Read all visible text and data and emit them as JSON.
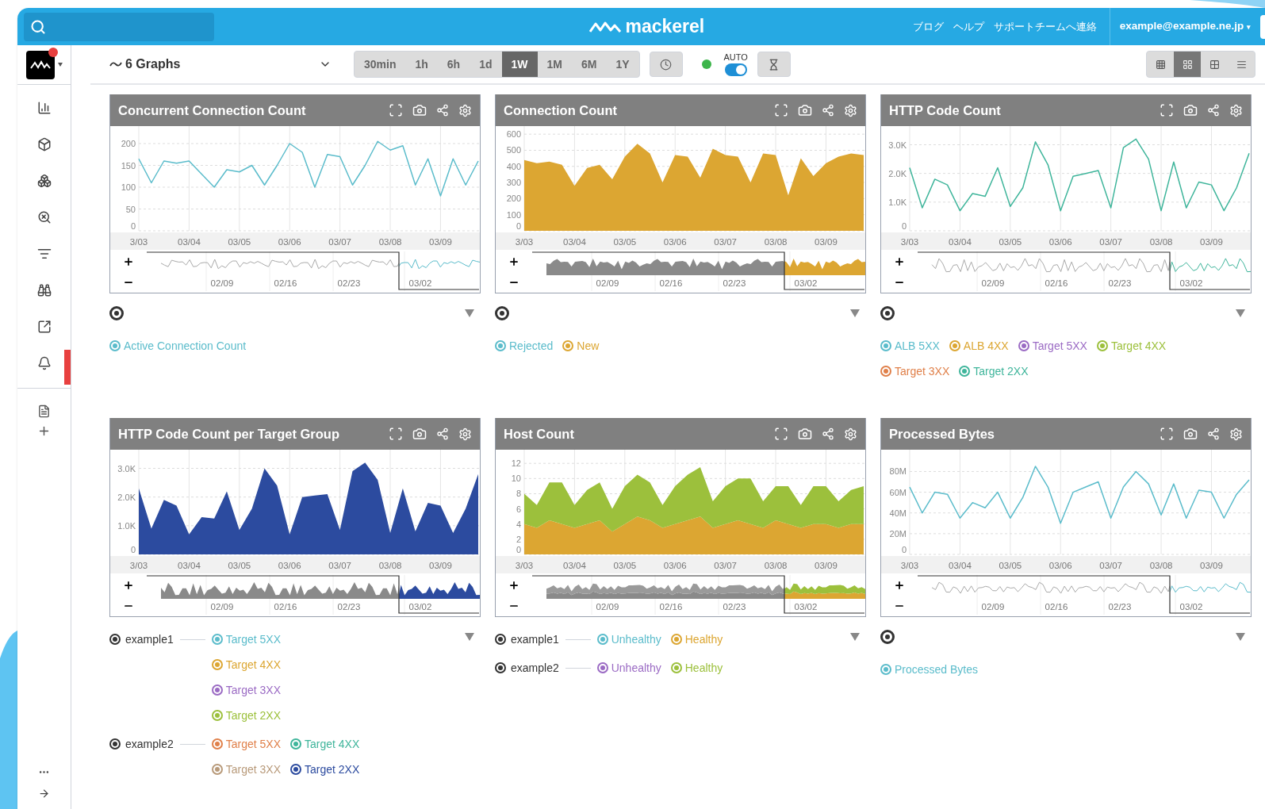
{
  "topbar": {
    "logo": "mackerel",
    "links": [
      "ブログ",
      "ヘルプ",
      "サポートチームへ連絡"
    ],
    "account": "example@example.ne.jp",
    "account_caret": "▾"
  },
  "sidebar": {
    "main": [
      {
        "kind": "chart",
        "alert": false
      },
      {
        "kind": "cube",
        "alert": false
      },
      {
        "kind": "cubes",
        "alert": false
      },
      {
        "kind": "inspect",
        "alert": false
      },
      {
        "kind": "filter",
        "alert": false
      },
      {
        "kind": "binoculars",
        "alert": false
      },
      {
        "kind": "export",
        "alert": false
      },
      {
        "kind": "bell",
        "alert": true
      }
    ],
    "secondary": [
      {
        "kind": "document"
      },
      {
        "kind": "add"
      }
    ],
    "bottom": [
      {
        "kind": "more"
      },
      {
        "kind": "collapse"
      }
    ]
  },
  "toolbar": {
    "graph_picker": "6 Graphs",
    "ranges": [
      {
        "label": "30min",
        "selected": false
      },
      {
        "label": "1h",
        "selected": false
      },
      {
        "label": "6h",
        "selected": false
      },
      {
        "label": "1d",
        "selected": false
      },
      {
        "label": "1W",
        "selected": true
      },
      {
        "label": "1M",
        "selected": false
      },
      {
        "label": "6M",
        "selected": false
      },
      {
        "label": "1Y",
        "selected": false
      }
    ],
    "connected": true,
    "auto_refresh": {
      "label": "AUTO",
      "on": true
    },
    "layouts": [
      {
        "kind": "dense",
        "selected": false
      },
      {
        "kind": "grid3",
        "selected": true
      },
      {
        "kind": "grid2",
        "selected": false
      },
      {
        "kind": "list",
        "selected": false
      }
    ]
  },
  "graphs": [
    {
      "title": "Concurrent Connection Count",
      "chart_data": {
        "type": "line",
        "categories": [
          "3/03",
          null,
          null,
          null,
          "03/04",
          null,
          null,
          null,
          "03/05",
          null,
          null,
          null,
          "03/06",
          null,
          null,
          null,
          "03/07",
          null,
          null,
          null,
          "03/08",
          null,
          null,
          null,
          "03/09",
          null,
          null,
          null
        ],
        "grid": true,
        "ylim": [
          0,
          240
        ],
        "yticks": [
          0,
          50,
          100,
          150,
          200
        ],
        "series": [
          {
            "color": "#5bbccb",
            "values": [
              165,
              110,
              160,
              155,
              160,
              130,
              100,
              140,
              135,
              150,
              105,
              150,
              200,
              180,
              100,
              175,
              170,
              105,
              150,
              205,
              185,
              195,
              105,
              165,
              80,
              165,
              105,
              160
            ]
          }
        ]
      },
      "navigator": {
        "dates": [
          "02/09",
          "02/16",
          "02/23",
          "03/02"
        ]
      },
      "legend": {
        "groups": [
          {
            "rows": [
              [
                {
                  "label": "Active Connection Count",
                  "color": "#5bbccb"
                }
              ]
            ]
          }
        ]
      }
    },
    {
      "title": "Connection Count",
      "chart_data": {
        "type": "area",
        "categories": [
          "3/03",
          null,
          null,
          null,
          "03/04",
          null,
          null,
          null,
          "03/05",
          null,
          null,
          null,
          "03/06",
          null,
          null,
          null,
          "03/07",
          null,
          null,
          null,
          "03/08",
          null,
          null,
          null,
          "03/09",
          null,
          null,
          null
        ],
        "grid": true,
        "ylim": [
          0,
          650
        ],
        "yticks": [
          0,
          100,
          200,
          300,
          400,
          500,
          600
        ],
        "series": [
          {
            "color": "#dca632",
            "values": [
              440,
              420,
              430,
              410,
              280,
              390,
              410,
              320,
              460,
              540,
              480,
              300,
              470,
              460,
              330,
              510,
              470,
              460,
              300,
              480,
              470,
              220,
              450,
              340,
              420,
              460,
              480,
              470
            ]
          }
        ]
      },
      "navigator": {
        "dates": [
          "02/09",
          "02/16",
          "02/23",
          "03/02"
        ]
      },
      "legend": {
        "groups": [
          {
            "rows": [
              [
                {
                  "label": "Rejected",
                  "color": "#5bbccb"
                },
                {
                  "label": "New",
                  "color": "#dca632"
                }
              ]
            ]
          }
        ]
      }
    },
    {
      "title": "HTTP Code Count",
      "chart_data": {
        "type": "line",
        "categories": [
          "3/03",
          null,
          null,
          null,
          "03/04",
          null,
          null,
          null,
          "03/05",
          null,
          null,
          null,
          "03/06",
          null,
          null,
          null,
          "03/07",
          null,
          null,
          null,
          "03/08",
          null,
          null,
          null,
          "03/09",
          null,
          null,
          null
        ],
        "grid": true,
        "ylim": [
          0,
          3650
        ],
        "yticks": [
          {
            "value": 0,
            "label": "0"
          },
          {
            "value": 1000,
            "label": "1.0K"
          },
          {
            "value": 2000,
            "label": "2.0K"
          },
          {
            "value": 3000,
            "label": "3.0K"
          }
        ],
        "series": [
          {
            "color": "#3fb59b",
            "values": [
              2200,
              800,
              1800,
              1600,
              700,
              1300,
              1200,
              2200,
              850,
              1500,
              3100,
              2300,
              700,
              1900,
              2000,
              2100,
              800,
              2900,
              3200,
              2500,
              700,
              2400,
              800,
              1700,
              1600,
              700,
              1500,
              2700
            ]
          }
        ]
      },
      "navigator": {
        "dates": [
          "02/09",
          "02/16",
          "02/23",
          "03/02"
        ]
      },
      "legend": {
        "groups": [
          {
            "rows": [
              [
                {
                  "label": "ALB 5XX",
                  "color": "#5bbccb"
                },
                {
                  "label": "ALB 4XX",
                  "color": "#dca632"
                },
                {
                  "label": "Target 5XX",
                  "color": "#9b6bc4"
                },
                {
                  "label": "Target 4XX",
                  "color": "#9cc03c"
                }
              ],
              [
                {
                  "label": "Target 3XX",
                  "color": "#e0804a"
                },
                {
                  "label": "Target 2XX",
                  "color": "#3fb59b"
                }
              ]
            ]
          }
        ]
      }
    },
    {
      "title": "HTTP Code Count per Target Group",
      "chart_data": {
        "type": "area",
        "categories": [
          "3/03",
          null,
          null,
          null,
          "03/04",
          null,
          null,
          null,
          "03/05",
          null,
          null,
          null,
          "03/06",
          null,
          null,
          null,
          "03/07",
          null,
          null,
          null,
          "03/08",
          null,
          null,
          null,
          "03/09",
          null,
          null,
          null
        ],
        "grid": true,
        "ylim": [
          0,
          3650
        ],
        "yticks": [
          {
            "value": 0,
            "label": "0"
          },
          {
            "value": 1000,
            "label": "1.0K"
          },
          {
            "value": 2000,
            "label": "2.0K"
          },
          {
            "value": 3000,
            "label": "3.0K"
          }
        ],
        "series": [
          {
            "color": "#2c4b9f",
            "values": [
              2300,
              900,
              1900,
              1700,
              700,
              1300,
              1250,
              2200,
              850,
              1600,
              3000,
              2400,
              700,
              2000,
              2050,
              2100,
              850,
              2900,
              3200,
              2600,
              750,
              2300,
              800,
              1800,
              1700,
              750,
              1600,
              2800
            ]
          }
        ]
      },
      "navigator": {
        "dates": [
          "02/09",
          "02/16",
          "02/23",
          "03/02"
        ]
      },
      "legend": {
        "groups": [
          {
            "host": "example1",
            "rows": [
              [
                {
                  "label": "Target 5XX",
                  "color": "#5bbccb"
                }
              ],
              [
                {
                  "label": "Target 4XX",
                  "color": "#dca632"
                }
              ],
              [
                {
                  "label": "Target 3XX",
                  "color": "#9b6bc4"
                }
              ],
              [
                {
                  "label": "Target 2XX",
                  "color": "#9cc03c"
                }
              ]
            ]
          },
          {
            "host": "example2",
            "rows": [
              [
                {
                  "label": "Target 5XX",
                  "color": "#e0804a"
                },
                {
                  "label": "Target 4XX",
                  "color": "#3fb59b"
                }
              ],
              [
                {
                  "label": "Target 3XX",
                  "color": "#b89a7a"
                },
                {
                  "label": "Target 2XX",
                  "color": "#2c4b9f"
                }
              ]
            ]
          }
        ]
      }
    },
    {
      "title": "Host Count",
      "chart_data": {
        "type": "area",
        "stacked": true,
        "categories": [
          "3/03",
          null,
          null,
          null,
          "03/04",
          null,
          null,
          null,
          "03/05",
          null,
          null,
          null,
          "03/06",
          null,
          null,
          null,
          "03/07",
          null,
          null,
          null,
          "03/08",
          null,
          null,
          null,
          "03/09",
          null,
          null,
          null
        ],
        "grid": true,
        "ylim": [
          0,
          13.8
        ],
        "yticks": [
          0,
          2,
          4,
          6,
          8,
          10,
          12
        ],
        "series": [
          {
            "color": "#dca632",
            "values": [
              4,
              3.5,
              4.5,
              4,
              3.5,
              4,
              4.5,
              3,
              4,
              5,
              4.5,
              3.5,
              4,
              4.5,
              5,
              3.5,
              4,
              4.5,
              4,
              3.5,
              4.5,
              4,
              3.5,
              4,
              4,
              3.5,
              4,
              4
            ]
          },
          {
            "color": "#9cc03c",
            "values": [
              4,
              3,
              5,
              5.5,
              3,
              4.5,
              5,
              3,
              5,
              5.5,
              5,
              3,
              5,
              6,
              6.5,
              3.5,
              5,
              5.5,
              6,
              3.5,
              4.5,
              5,
              3,
              5,
              5,
              3.5,
              4.5,
              5
            ]
          }
        ]
      },
      "navigator": {
        "dates": [
          "02/09",
          "02/16",
          "02/23",
          "03/02"
        ]
      },
      "legend": {
        "groups": [
          {
            "host": "example1",
            "rows": [
              [
                {
                  "label": "Unhealthy",
                  "color": "#5bbccb"
                },
                {
                  "label": "Healthy",
                  "color": "#dca632"
                }
              ]
            ]
          },
          {
            "host": "example2",
            "rows": [
              [
                {
                  "label": "Unhealthy",
                  "color": "#9b6bc4"
                },
                {
                  "label": "Healthy",
                  "color": "#9cc03c"
                }
              ]
            ]
          }
        ]
      }
    },
    {
      "title": "Processed Bytes",
      "chart_data": {
        "type": "line",
        "categories": [
          "3/03",
          null,
          null,
          null,
          "03/04",
          null,
          null,
          null,
          "03/05",
          null,
          null,
          null,
          "03/06",
          null,
          null,
          null,
          "03/07",
          null,
          null,
          null,
          "03/08",
          null,
          null,
          null,
          "03/09",
          null,
          null,
          null
        ],
        "grid": true,
        "ylim": [
          0,
          101
        ],
        "yticks": [
          {
            "value": 0,
            "label": "0"
          },
          {
            "value": 20,
            "label": "20M"
          },
          {
            "value": 40,
            "label": "40M"
          },
          {
            "value": 60,
            "label": "60M"
          },
          {
            "value": 80,
            "label": "80M"
          }
        ],
        "series": [
          {
            "color": "#5bbccb",
            "values": [
              65,
              40,
              60,
              58,
              35,
              50,
              45,
              60,
              35,
              55,
              85,
              65,
              30,
              60,
              65,
              70,
              35,
              65,
              80,
              68,
              38,
              68,
              35,
              62,
              60,
              35,
              58,
              72
            ]
          }
        ]
      },
      "navigator": {
        "dates": [
          "02/09",
          "02/16",
          "02/23",
          "03/02"
        ]
      },
      "legend": {
        "groups": [
          {
            "rows": [
              [
                {
                  "label": "Processed Bytes",
                  "color": "#5bbccb"
                }
              ]
            ]
          }
        ]
      }
    }
  ]
}
